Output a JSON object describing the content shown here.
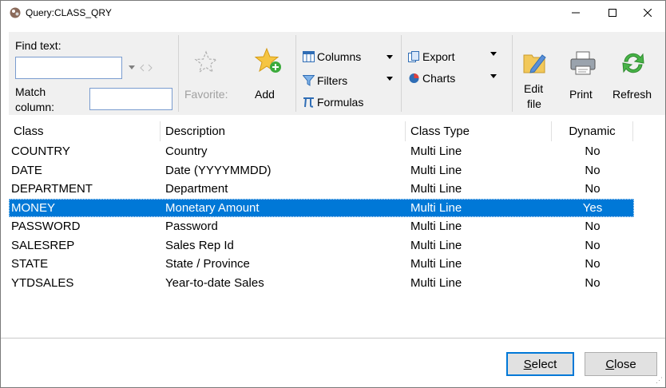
{
  "window": {
    "title": "Query:CLASS_QRY"
  },
  "toolbar": {
    "find_text_label": "Find text:",
    "find_text_value": "",
    "match_column_label_1": "Match",
    "match_column_label_2": "column:",
    "match_column_value": "",
    "favorites_label": "Favorite:",
    "add_label": "Add",
    "columns_label": "Columns",
    "filters_label": "Filters",
    "formulas_label": "Formulas",
    "export_label": "Export",
    "charts_label": "Charts",
    "edit_file_label_1": "Edit",
    "edit_file_label_2": "file",
    "print_label": "Print",
    "refresh_label": "Refresh"
  },
  "grid": {
    "columns": [
      "Class",
      "Description",
      "Class Type",
      "Dynamic"
    ],
    "rows": [
      {
        "class": "COUNTRY",
        "description": "Country",
        "type": "Multi Line",
        "dynamic": "No"
      },
      {
        "class": "DATE",
        "description": "Date (YYYYMMDD)",
        "type": "Multi Line",
        "dynamic": "No"
      },
      {
        "class": "DEPARTMENT",
        "description": "Department",
        "type": "Multi Line",
        "dynamic": "No"
      },
      {
        "class": "MONEY",
        "description": "Monetary Amount",
        "type": "Multi Line",
        "dynamic": "Yes"
      },
      {
        "class": "PASSWORD",
        "description": "Password",
        "type": "Multi Line",
        "dynamic": "No"
      },
      {
        "class": "SALESREP",
        "description": "Sales Rep Id",
        "type": "Multi Line",
        "dynamic": "No"
      },
      {
        "class": "STATE",
        "description": "State / Province",
        "type": "Multi Line",
        "dynamic": "No"
      },
      {
        "class": "YTDSALES",
        "description": "Year-to-date Sales",
        "type": "Multi Line",
        "dynamic": "No"
      }
    ],
    "selected_index": 3
  },
  "buttons": {
    "select_accel": "S",
    "select_rest": "elect",
    "close_accel": "C",
    "close_rest": "lose"
  },
  "colors": {
    "selection": "#0078d7",
    "toolbar_bg": "#f0f0f0"
  }
}
